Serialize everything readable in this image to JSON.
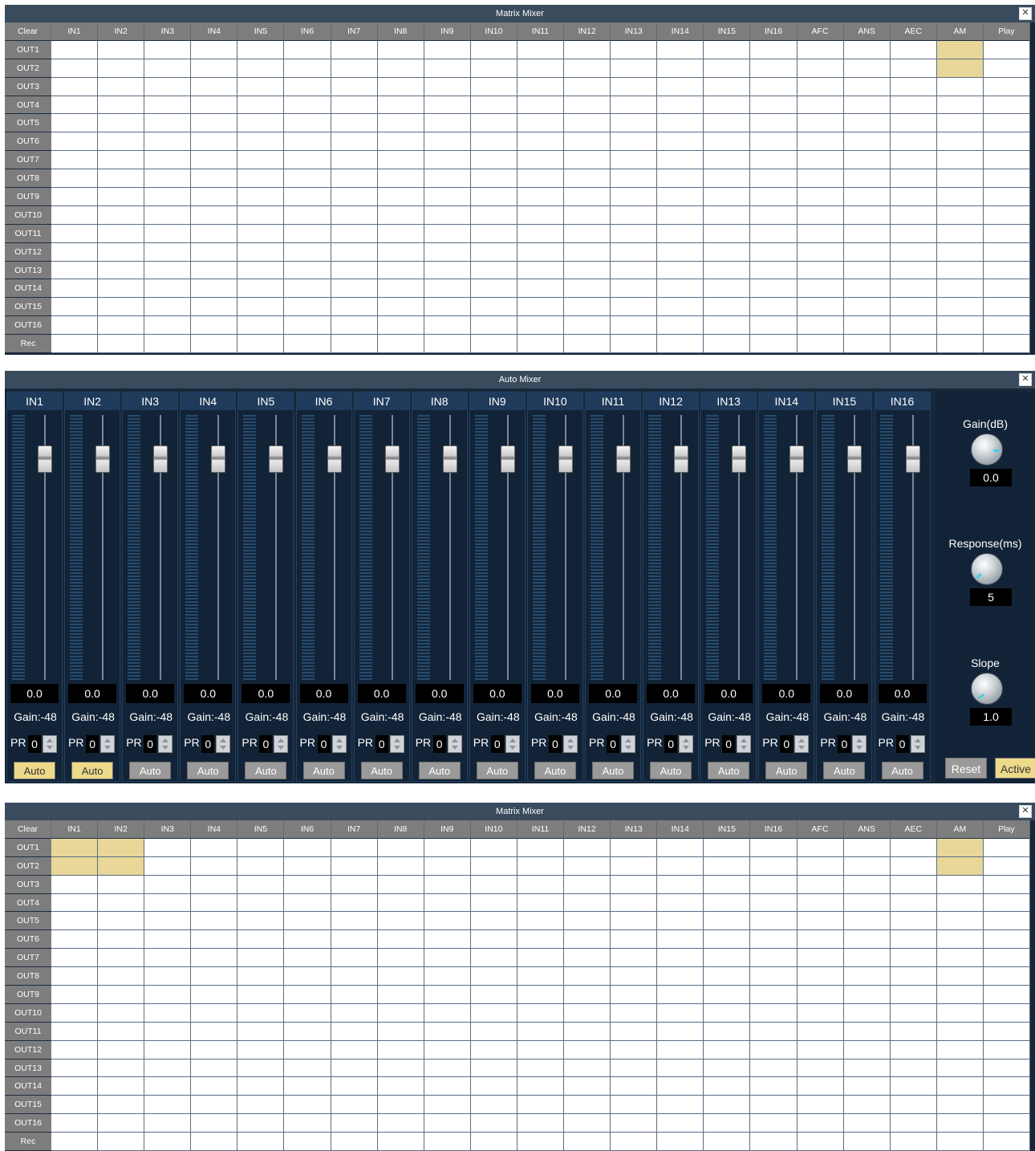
{
  "matrix_top": {
    "title": "Matrix Mixer",
    "close_symbol": "✕",
    "corner_button": "Clear",
    "columns": [
      "IN1",
      "IN2",
      "IN3",
      "IN4",
      "IN5",
      "IN6",
      "IN7",
      "IN8",
      "IN9",
      "IN10",
      "IN11",
      "IN12",
      "IN13",
      "IN14",
      "IN15",
      "IN16",
      "AFC",
      "ANS",
      "AEC",
      "AM",
      "Play"
    ],
    "rows": [
      "OUT1",
      "OUT2",
      "OUT3",
      "OUT4",
      "OUT5",
      "OUT6",
      "OUT7",
      "OUT8",
      "OUT9",
      "OUT10",
      "OUT11",
      "OUT12",
      "OUT13",
      "OUT14",
      "OUT15",
      "OUT16",
      "Rec"
    ],
    "active_cells": [
      [
        0,
        19
      ],
      [
        1,
        19
      ]
    ]
  },
  "auto_mixer": {
    "title": "Auto Mixer",
    "close_symbol": "✕",
    "channels": [
      {
        "name": "IN1",
        "fader_value": "0.0",
        "gain": "Gain:-48",
        "pr_label": "PR",
        "pr_value": "0",
        "auto_label": "Auto",
        "auto_on": true
      },
      {
        "name": "IN2",
        "fader_value": "0.0",
        "gain": "Gain:-48",
        "pr_label": "PR",
        "pr_value": "0",
        "auto_label": "Auto",
        "auto_on": true
      },
      {
        "name": "IN3",
        "fader_value": "0.0",
        "gain": "Gain:-48",
        "pr_label": "PR",
        "pr_value": "0",
        "auto_label": "Auto",
        "auto_on": false
      },
      {
        "name": "IN4",
        "fader_value": "0.0",
        "gain": "Gain:-48",
        "pr_label": "PR",
        "pr_value": "0",
        "auto_label": "Auto",
        "auto_on": false
      },
      {
        "name": "IN5",
        "fader_value": "0.0",
        "gain": "Gain:-48",
        "pr_label": "PR",
        "pr_value": "0",
        "auto_label": "Auto",
        "auto_on": false
      },
      {
        "name": "IN6",
        "fader_value": "0.0",
        "gain": "Gain:-48",
        "pr_label": "PR",
        "pr_value": "0",
        "auto_label": "Auto",
        "auto_on": false
      },
      {
        "name": "IN7",
        "fader_value": "0.0",
        "gain": "Gain:-48",
        "pr_label": "PR",
        "pr_value": "0",
        "auto_label": "Auto",
        "auto_on": false
      },
      {
        "name": "IN8",
        "fader_value": "0.0",
        "gain": "Gain:-48",
        "pr_label": "PR",
        "pr_value": "0",
        "auto_label": "Auto",
        "auto_on": false
      },
      {
        "name": "IN9",
        "fader_value": "0.0",
        "gain": "Gain:-48",
        "pr_label": "PR",
        "pr_value": "0",
        "auto_label": "Auto",
        "auto_on": false
      },
      {
        "name": "IN10",
        "fader_value": "0.0",
        "gain": "Gain:-48",
        "pr_label": "PR",
        "pr_value": "0",
        "auto_label": "Auto",
        "auto_on": false
      },
      {
        "name": "IN11",
        "fader_value": "0.0",
        "gain": "Gain:-48",
        "pr_label": "PR",
        "pr_value": "0",
        "auto_label": "Auto",
        "auto_on": false
      },
      {
        "name": "IN12",
        "fader_value": "0.0",
        "gain": "Gain:-48",
        "pr_label": "PR",
        "pr_value": "0",
        "auto_label": "Auto",
        "auto_on": false
      },
      {
        "name": "IN13",
        "fader_value": "0.0",
        "gain": "Gain:-48",
        "pr_label": "PR",
        "pr_value": "0",
        "auto_label": "Auto",
        "auto_on": false
      },
      {
        "name": "IN14",
        "fader_value": "0.0",
        "gain": "Gain:-48",
        "pr_label": "PR",
        "pr_value": "0",
        "auto_label": "Auto",
        "auto_on": false
      },
      {
        "name": "IN15",
        "fader_value": "0.0",
        "gain": "Gain:-48",
        "pr_label": "PR",
        "pr_value": "0",
        "auto_label": "Auto",
        "auto_on": false
      },
      {
        "name": "IN16",
        "fader_value": "0.0",
        "gain": "Gain:-48",
        "pr_label": "PR",
        "pr_value": "0",
        "auto_label": "Auto",
        "auto_on": false
      }
    ],
    "gain_label": "Gain(dB)",
    "gain_value": "0.0",
    "response_label": "Response(ms)",
    "response_value": "5",
    "slope_label": "Slope",
    "slope_value": "1.0",
    "reset_label": "Reset",
    "active_label": "Active"
  },
  "matrix_bottom": {
    "title": "Matrix Mixer",
    "close_symbol": "✕",
    "corner_button": "Clear",
    "columns": [
      "IN1",
      "IN2",
      "IN3",
      "IN4",
      "IN5",
      "IN6",
      "IN7",
      "IN8",
      "IN9",
      "IN10",
      "IN11",
      "IN12",
      "IN13",
      "IN14",
      "IN15",
      "IN16",
      "AFC",
      "ANS",
      "AEC",
      "AM",
      "Play"
    ],
    "rows": [
      "OUT1",
      "OUT2",
      "OUT3",
      "OUT4",
      "OUT5",
      "OUT6",
      "OUT7",
      "OUT8",
      "OUT9",
      "OUT10",
      "OUT11",
      "OUT12",
      "OUT13",
      "OUT14",
      "OUT15",
      "OUT16",
      "Rec"
    ],
    "active_cells": [
      [
        0,
        0
      ],
      [
        0,
        1
      ],
      [
        1,
        0
      ],
      [
        1,
        1
      ],
      [
        0,
        19
      ],
      [
        1,
        19
      ]
    ]
  },
  "colors": {
    "panel_bg": "#16273a",
    "titlebar_bg": "#3a4b5d",
    "header_gray": "#7d7d7d",
    "cell_active": "#e8d798",
    "button_active": "#ecd98a",
    "button_inactive": "#9a9a9a",
    "dial_indicator": "#3fd0e6"
  },
  "icons": {
    "close": "close-icon",
    "fader": "fader-knob-icon",
    "dial": "rotary-knob-icon",
    "spinner": "spinner-arrows-icon"
  }
}
